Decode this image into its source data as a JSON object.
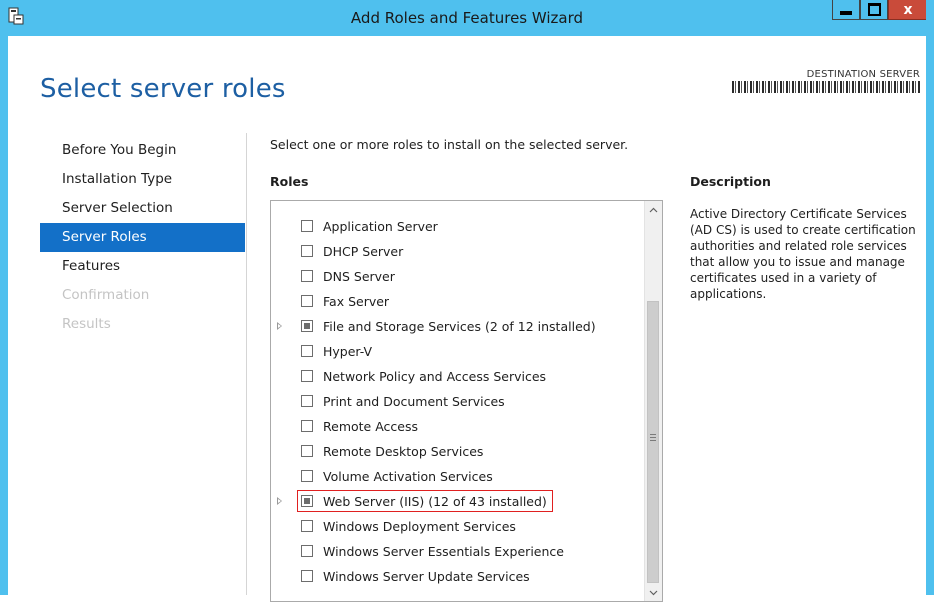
{
  "window": {
    "title": "Add Roles and Features Wizard",
    "minimize_icon": "minimize-icon",
    "maximize_icon": "maximize-icon",
    "close_label": "x"
  },
  "header": {
    "page_title": "Select server roles",
    "destination_label": "DESTINATION SERVER"
  },
  "nav": {
    "items": [
      {
        "label": "Before You Begin",
        "state": "normal"
      },
      {
        "label": "Installation Type",
        "state": "normal"
      },
      {
        "label": "Server Selection",
        "state": "normal"
      },
      {
        "label": "Server Roles",
        "state": "active"
      },
      {
        "label": "Features",
        "state": "normal"
      },
      {
        "label": "Confirmation",
        "state": "disabled"
      },
      {
        "label": "Results",
        "state": "disabled"
      }
    ]
  },
  "main": {
    "instruction": "Select one or more roles to install on the selected server.",
    "roles_header": "Roles",
    "roles": [
      {
        "label": "Application Server",
        "expandable": false,
        "check": "unchecked"
      },
      {
        "label": "DHCP Server",
        "expandable": false,
        "check": "unchecked"
      },
      {
        "label": "DNS Server",
        "expandable": false,
        "check": "unchecked"
      },
      {
        "label": "Fax Server",
        "expandable": false,
        "check": "unchecked"
      },
      {
        "label": "File and Storage Services (2 of 12 installed)",
        "expandable": true,
        "check": "partial"
      },
      {
        "label": "Hyper-V",
        "expandable": false,
        "check": "unchecked"
      },
      {
        "label": "Network Policy and Access Services",
        "expandable": false,
        "check": "unchecked"
      },
      {
        "label": "Print and Document Services",
        "expandable": false,
        "check": "unchecked"
      },
      {
        "label": "Remote Access",
        "expandable": false,
        "check": "unchecked"
      },
      {
        "label": "Remote Desktop Services",
        "expandable": false,
        "check": "unchecked"
      },
      {
        "label": "Volume Activation Services",
        "expandable": false,
        "check": "unchecked"
      },
      {
        "label": "Web Server (IIS) (12 of 43 installed)",
        "expandable": true,
        "check": "partial",
        "highlighted": true
      },
      {
        "label": "Windows Deployment Services",
        "expandable": false,
        "check": "unchecked"
      },
      {
        "label": "Windows Server Essentials Experience",
        "expandable": false,
        "check": "unchecked"
      },
      {
        "label": "Windows Server Update Services",
        "expandable": false,
        "check": "unchecked"
      }
    ],
    "description_header": "Description",
    "description_text": "Active Directory Certificate Services (AD CS) is used to create certification authorities and related role services that allow you to issue and manage certificates used in a variety of applications."
  },
  "colors": {
    "titlebar": "#4fc0ee",
    "accent": "#1370c8",
    "page_title": "#1d5fa3",
    "highlight_border": "#e02020",
    "close_button": "#c94b3a"
  }
}
